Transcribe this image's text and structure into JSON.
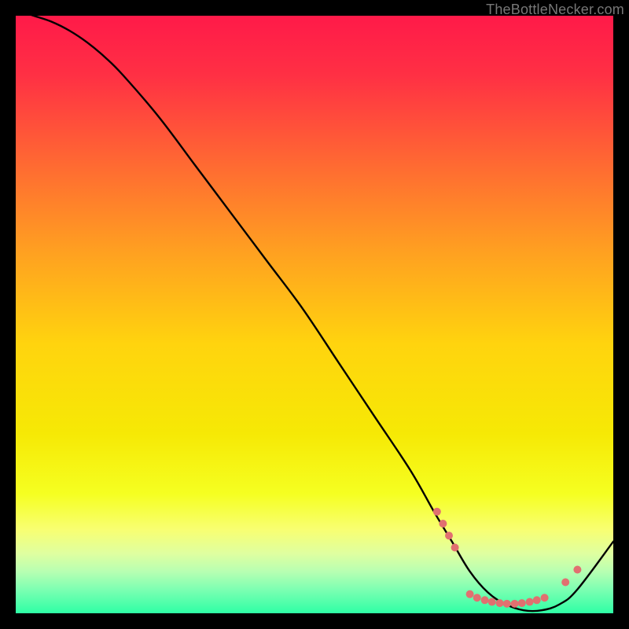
{
  "watermark": "TheBottleNecker.com",
  "chart_data": {
    "type": "line",
    "title": "",
    "xlabel": "",
    "ylabel": "",
    "xlim": [
      0,
      100
    ],
    "ylim": [
      0,
      100
    ],
    "grid": false,
    "background": {
      "type": "vertical-gradient",
      "stops": [
        {
          "pos": 0.0,
          "color": "#ff1a49"
        },
        {
          "pos": 0.1,
          "color": "#ff3044"
        },
        {
          "pos": 0.25,
          "color": "#ff6a32"
        },
        {
          "pos": 0.4,
          "color": "#ffa220"
        },
        {
          "pos": 0.55,
          "color": "#ffd40e"
        },
        {
          "pos": 0.7,
          "color": "#f6e905"
        },
        {
          "pos": 0.8,
          "color": "#f5ff21"
        },
        {
          "pos": 0.86,
          "color": "#f8ff72"
        },
        {
          "pos": 0.9,
          "color": "#dfffa0"
        },
        {
          "pos": 0.93,
          "color": "#b8ffb2"
        },
        {
          "pos": 0.96,
          "color": "#7dffb2"
        },
        {
          "pos": 1.0,
          "color": "#2effa5"
        }
      ]
    },
    "series": [
      {
        "name": "bottleneck-curve",
        "color": "#000000",
        "x": [
          0,
          3,
          6,
          9,
          12,
          15,
          18,
          24,
          30,
          36,
          42,
          48,
          54,
          60,
          66,
          70,
          73,
          76,
          79,
          82,
          85,
          88,
          91,
          94,
          100
        ],
        "y": [
          101,
          100,
          99,
          97.5,
          95.5,
          93,
          90,
          83,
          75,
          67,
          59,
          51,
          42,
          33,
          24,
          17,
          12,
          7,
          3.5,
          1.5,
          0.5,
          0.5,
          1.5,
          4,
          12
        ]
      }
    ],
    "markers": {
      "name": "highlight-points",
      "color": "#e17070",
      "radius": 5,
      "points": [
        {
          "x": 70.5,
          "y": 17
        },
        {
          "x": 71.5,
          "y": 15
        },
        {
          "x": 72.5,
          "y": 13
        },
        {
          "x": 73.5,
          "y": 11
        },
        {
          "x": 76.0,
          "y": 3.2
        },
        {
          "x": 77.2,
          "y": 2.6
        },
        {
          "x": 78.5,
          "y": 2.2
        },
        {
          "x": 79.7,
          "y": 1.9
        },
        {
          "x": 81.0,
          "y": 1.7
        },
        {
          "x": 82.2,
          "y": 1.6
        },
        {
          "x": 83.5,
          "y": 1.6
        },
        {
          "x": 84.7,
          "y": 1.7
        },
        {
          "x": 86.0,
          "y": 1.9
        },
        {
          "x": 87.2,
          "y": 2.2
        },
        {
          "x": 88.5,
          "y": 2.6
        },
        {
          "x": 92.0,
          "y": 5.2
        },
        {
          "x": 94.0,
          "y": 7.3
        }
      ]
    }
  }
}
